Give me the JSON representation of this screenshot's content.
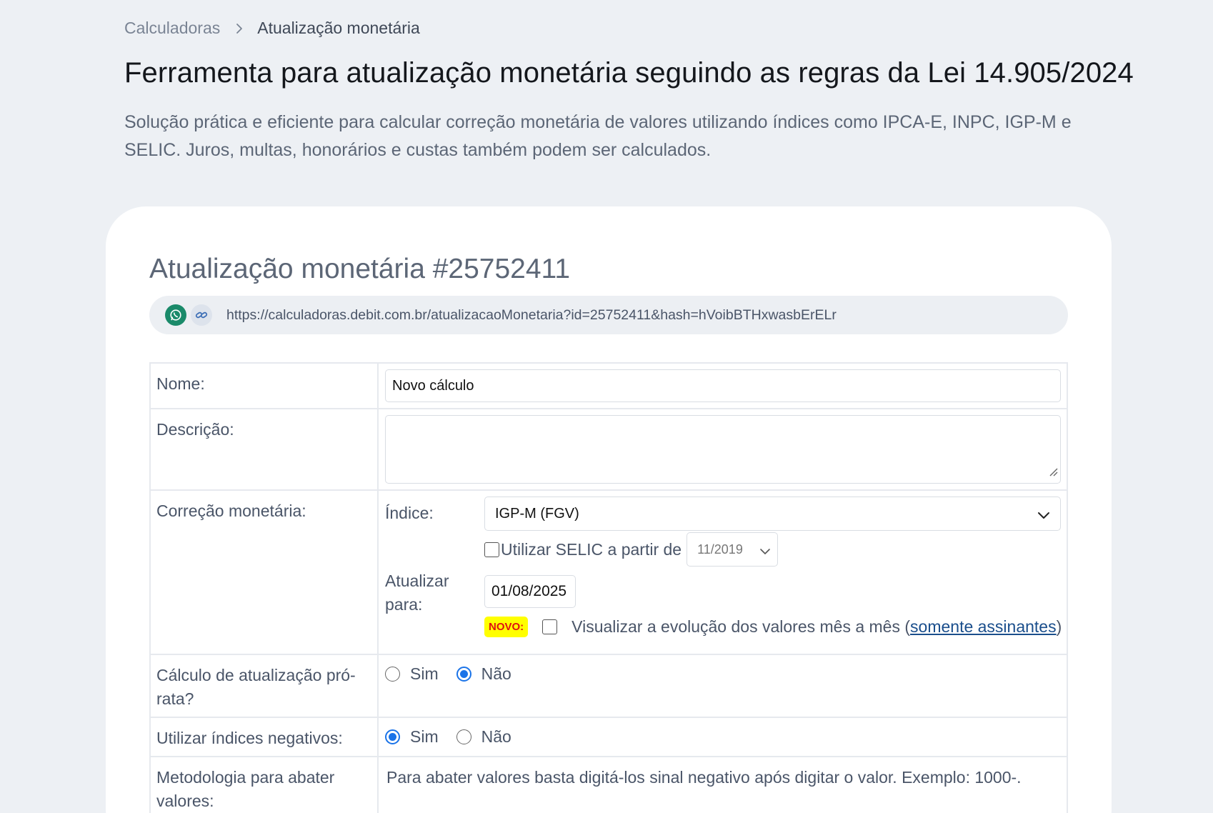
{
  "breadcrumb": {
    "parent": "Calculadoras",
    "current": "Atualização monetária"
  },
  "header": {
    "title": "Ferramenta para atualização monetária seguindo as regras da Lei 14.905/2024",
    "subtitle": "Solução prática e eficiente para calcular correção monetária de valores utilizando índices como IPCA-E, INPC, IGP-M e SELIC. Juros, multas, honorários e custas também podem ser calculados."
  },
  "card": {
    "title": "Atualização monetária #25752411",
    "share_url": "https://calculadoras.debit.com.br/atualizacaoMonetaria?id=25752411&hash=hVoibBTHxwasbErELr"
  },
  "form": {
    "nome": {
      "label": "Nome:",
      "value": "Novo cálculo"
    },
    "descricao": {
      "label": "Descrição:",
      "value": ""
    },
    "correcao": {
      "label": "Correção monetária:",
      "indice_label": "Índice:",
      "indice_value": "IGP-M (FGV)",
      "selic_label": "Utilizar SELIC a partir de",
      "selic_checked": false,
      "selic_date": "11/2019",
      "atualizar_label": "Atualizar para:",
      "atualizar_value": "01/08/2025",
      "novo_badge": "NOVO:",
      "evolucao_text": "Visualizar a evolução dos valores mês a mês (",
      "evolucao_link": "somente assinantes",
      "evolucao_close": ")"
    },
    "pro_rata": {
      "label": "Cálculo de atualização pró-rata?",
      "options": [
        "Sim",
        "Não"
      ],
      "selected": "Não"
    },
    "negativos": {
      "label": "Utilizar índices negativos:",
      "options": [
        "Sim",
        "Não"
      ],
      "selected": "Sim"
    },
    "metodologia": {
      "label": "Metodologia para abater valores:",
      "text": "Para abater valores basta digitá-los sinal negativo após digitar o valor. Exemplo: 1000-."
    }
  },
  "colors": {
    "background": "#edf0f4",
    "card": "#ffffff",
    "whatsapp": "#1a8a6a",
    "radio_accent": "#1a73e8",
    "badge_bg": "#ffff00",
    "badge_text": "#e01010",
    "link": "#1a4e8c"
  },
  "icons": [
    "chevron-right-icon",
    "whatsapp-icon",
    "link-icon",
    "chevron-down-icon",
    "resize-handle-icon"
  ]
}
